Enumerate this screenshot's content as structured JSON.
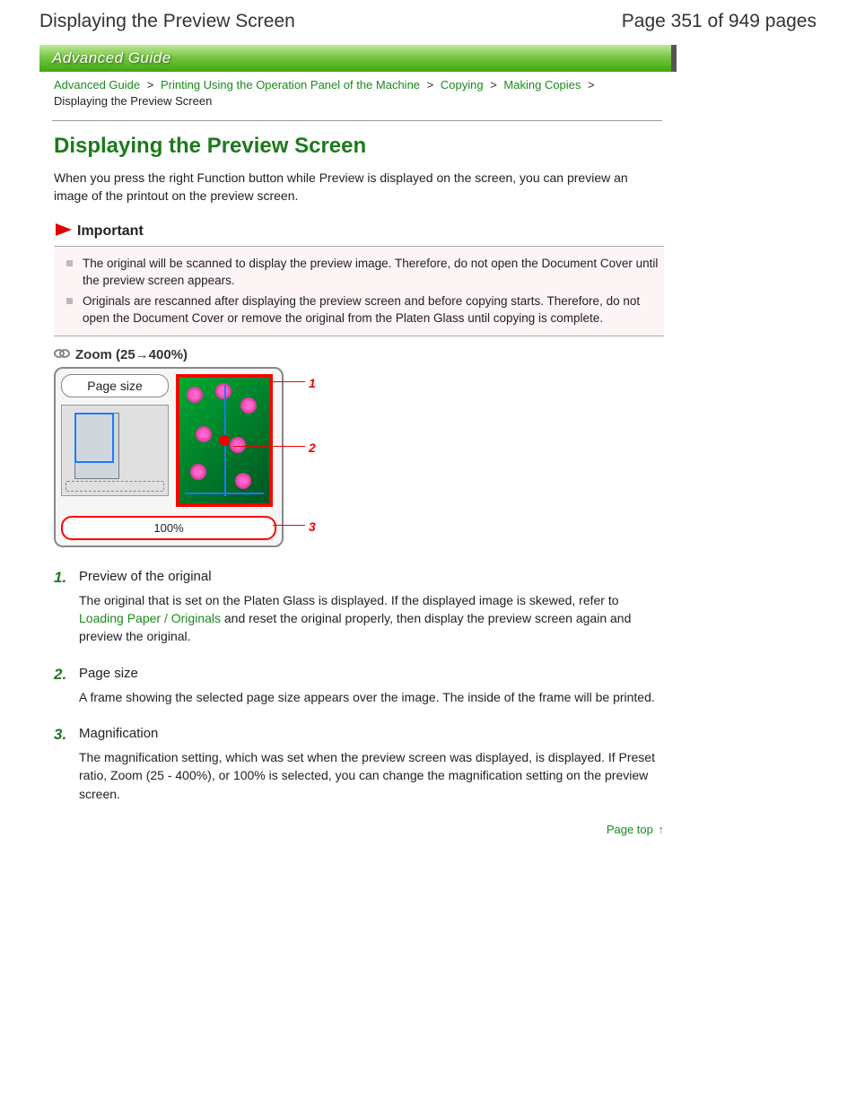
{
  "page": {
    "doc_title": "Displaying the Preview Screen",
    "pager": "Page 351 of 949 pages"
  },
  "header": {
    "guide_label": "Advanced Guide"
  },
  "breadcrumb": {
    "items": [
      "Advanced Guide",
      "Printing Using the Operation Panel of the Machine",
      "Copying",
      "Making Copies"
    ],
    "sep": ">",
    "current": "Displaying the Preview Screen"
  },
  "content": {
    "heading": "Displaying the Preview Screen",
    "intro": "When you press the right Function button while Preview is displayed on the screen, you can preview an image of the printout on the preview screen."
  },
  "important": {
    "label": "Important",
    "items": [
      "The original will be scanned to display the preview image. Therefore, do not open the Document Cover until the preview screen appears.",
      "Originals are rescanned after displaying the preview screen and before copying starts. Therefore, do not open the Document Cover or remove the original from the Platen Glass until copying is complete."
    ]
  },
  "screenshot": {
    "zoom_title": "Zoom (25→400%)",
    "page_size_label": "Page size",
    "bottom_value": "100%",
    "labels": [
      "1",
      "2",
      "3"
    ]
  },
  "features": [
    {
      "num": "1.",
      "title": "Preview of the original",
      "body_before": "The original that is set on the Platen Glass is displayed. If the displayed image is skewed, refer to ",
      "link": "Loading Paper / Originals",
      "body_after": " and reset the original properly, then display the preview screen again and preview the original."
    },
    {
      "num": "2.",
      "title": "Page size",
      "body_before": "A frame showing the selected page size appears over the image. The inside of the frame will be printed.",
      "link": "",
      "body_after": ""
    },
    {
      "num": "3.",
      "title": "Magnification",
      "body_before": "The magnification setting, which was set when the preview screen was displayed, is displayed. If Preset ratio, Zoom (25 - 400%), or 100% is selected, you can change the magnification setting on the preview screen.",
      "link": "",
      "body_after": ""
    }
  ],
  "footer": {
    "page_top": "Page top"
  }
}
